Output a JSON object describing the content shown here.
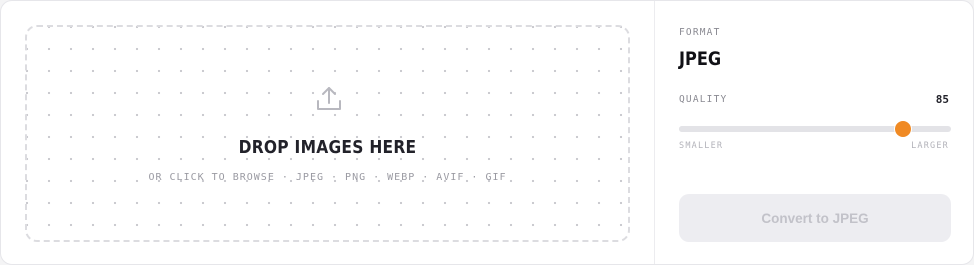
{
  "dropzone": {
    "title": "DROP IMAGES HERE",
    "subtitle": "OR CLICK TO BROWSE · JPEG · PNG · WEBP · AVIF · GIF",
    "icon": "upload-icon"
  },
  "format": {
    "label": "FORMAT",
    "value": "JPEG"
  },
  "quality": {
    "label": "QUALITY",
    "value": "85",
    "level": 85,
    "min_label": "SMALLER",
    "max_label": "LARGER"
  },
  "convert_button": {
    "label": "Convert to JPEG",
    "enabled": false
  },
  "colors": {
    "accent": "#f08a24",
    "button_bg": "#ededf1",
    "button_text": "#c2c2c9"
  }
}
